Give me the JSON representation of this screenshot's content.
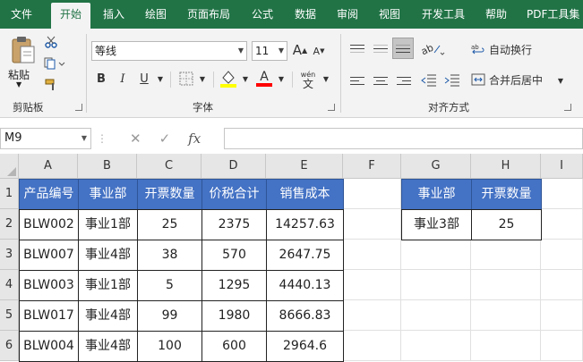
{
  "tabs": [
    "文件",
    "开始",
    "插入",
    "绘图",
    "页面布局",
    "公式",
    "数据",
    "审阅",
    "视图",
    "开发工具",
    "帮助",
    "PDF工具集"
  ],
  "active_tab_index": 1,
  "ribbon": {
    "clipboard": {
      "paste_label": "粘贴",
      "group_label": "剪贴板"
    },
    "font": {
      "font_name": "等线",
      "font_size": "11",
      "group_label": "字体",
      "bold": "B",
      "italic": "I",
      "underline": "U",
      "big_a": "A",
      "small_a": "A",
      "wen": "wén",
      "wen2": "文"
    },
    "alignment": {
      "wrap_text": "自动换行",
      "merge_center": "合并后居中",
      "group_label": "对齐方式"
    }
  },
  "formula_bar": {
    "name_box": "M9",
    "cancel": "✕",
    "enter": "✓",
    "fx": "fx",
    "formula": ""
  },
  "columns": [
    "A",
    "B",
    "C",
    "D",
    "E",
    "F",
    "G",
    "H",
    "I"
  ],
  "rows": [
    "1",
    "2",
    "3",
    "4",
    "5",
    "6"
  ],
  "table1": {
    "headers": [
      "产品编号",
      "事业部",
      "开票数量",
      "价税合计",
      "销售成本"
    ],
    "rows": [
      [
        "BLW002",
        "事业1部",
        "25",
        "2375",
        "14257.63"
      ],
      [
        "BLW007",
        "事业4部",
        "38",
        "570",
        "2647.75"
      ],
      [
        "BLW003",
        "事业1部",
        "5",
        "1295",
        "4440.13"
      ],
      [
        "BLW017",
        "事业4部",
        "99",
        "1980",
        "8666.83"
      ],
      [
        "BLW004",
        "事业4部",
        "100",
        "600",
        "2964.6"
      ]
    ]
  },
  "table2": {
    "headers": [
      "事业部",
      "开票数量"
    ],
    "row": [
      "事业3部",
      "25"
    ]
  },
  "colors": {
    "brand": "#217346",
    "header_fill": "#4472c4",
    "font_color_red": "#ff0000",
    "highlight_yellow": "#ffff00"
  }
}
